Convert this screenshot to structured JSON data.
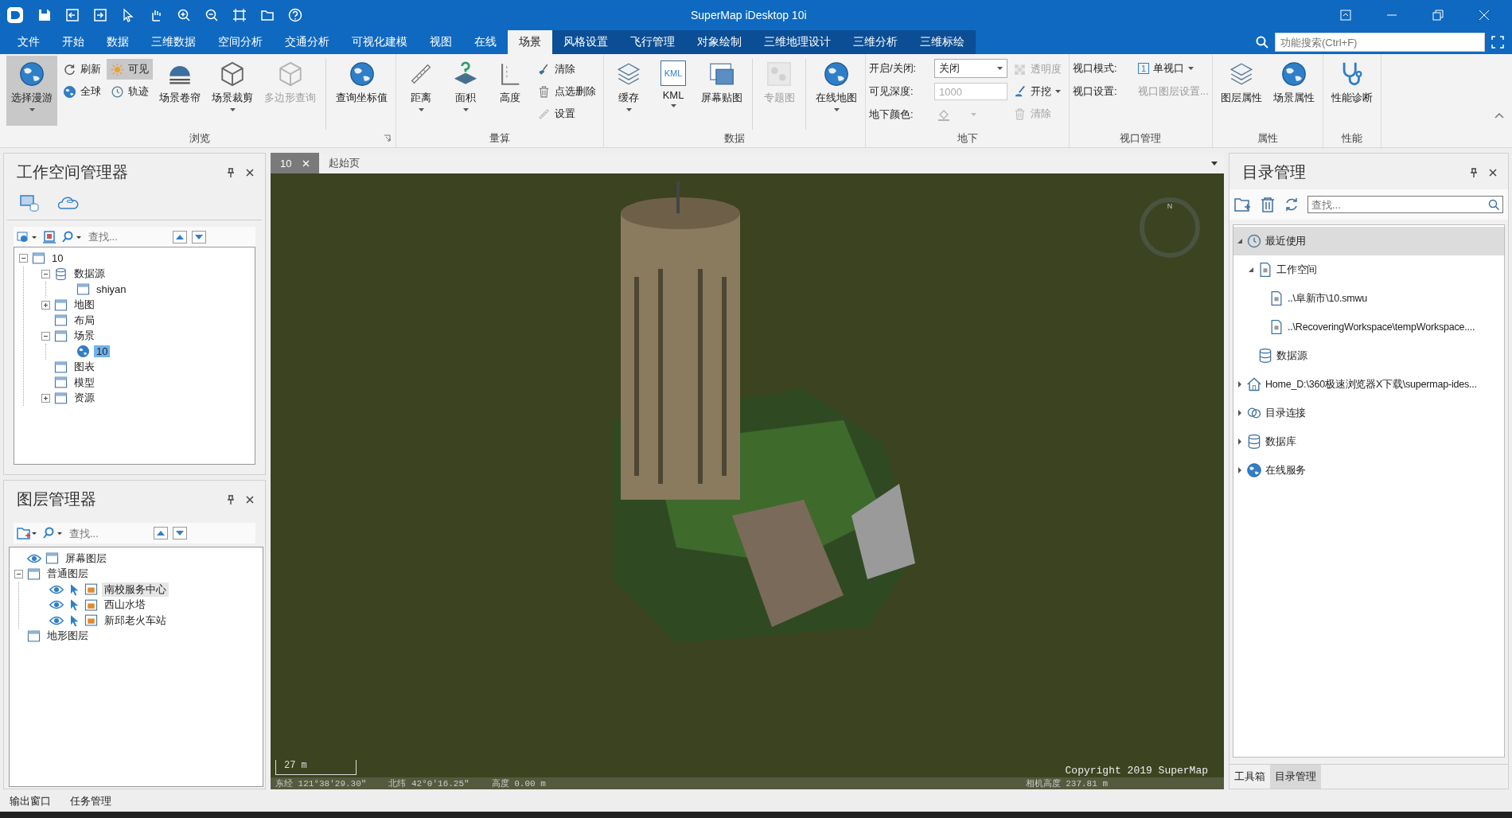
{
  "window": {
    "title": "SuperMap iDesktop 10i"
  },
  "menu_tabs": [
    {
      "label": "文件",
      "kind": "main",
      "selected": false
    },
    {
      "label": "开始",
      "kind": "main",
      "selected": false
    },
    {
      "label": "数据",
      "kind": "main",
      "selected": false
    },
    {
      "label": "三维数据",
      "kind": "main",
      "selected": false
    },
    {
      "label": "空间分析",
      "kind": "main",
      "selected": false
    },
    {
      "label": "交通分析",
      "kind": "main",
      "selected": false
    },
    {
      "label": "可视化建模",
      "kind": "main",
      "selected": false
    },
    {
      "label": "视图",
      "kind": "main",
      "selected": false
    },
    {
      "label": "在线",
      "kind": "main",
      "selected": false
    },
    {
      "label": "场景",
      "kind": "main",
      "selected": true
    },
    {
      "label": "风格设置",
      "kind": "context",
      "selected": false
    },
    {
      "label": "飞行管理",
      "kind": "context",
      "selected": false
    },
    {
      "label": "对象绘制",
      "kind": "context",
      "selected": false
    },
    {
      "label": "三维地理设计",
      "kind": "context",
      "selected": false
    },
    {
      "label": "三维分析",
      "kind": "context",
      "selected": false
    },
    {
      "label": "三维标绘",
      "kind": "context",
      "selected": false
    }
  ],
  "function_search": {
    "placeholder": "功能搜索(Ctrl+F)"
  },
  "ribbon": [
    {
      "label": "浏览",
      "launcher": true,
      "items": [
        {
          "kind": "large",
          "label": "选择漫游",
          "selected": true,
          "disabled": false,
          "dropdown": true
        },
        {
          "kind": "column",
          "items": [
            {
              "label": "刷新",
              "selected": false,
              "disabled": false,
              "dropdown": false
            },
            {
              "label": "全球",
              "selected": false,
              "disabled": false,
              "dropdown": false
            }
          ]
        },
        {
          "kind": "column",
          "items": [
            {
              "label": "可见",
              "selected": true,
              "disabled": false,
              "dropdown": false
            },
            {
              "label": "轨迹",
              "selected": false,
              "disabled": false,
              "dropdown": false
            }
          ]
        },
        {
          "kind": "large",
          "label": "场景卷帘",
          "selected": false,
          "disabled": false,
          "dropdown": false
        },
        {
          "kind": "large",
          "label": "场景裁剪",
          "selected": false,
          "disabled": false,
          "dropdown": true
        },
        {
          "kind": "large",
          "label": "多边形查询",
          "selected": false,
          "disabled": true,
          "dropdown": false
        },
        {
          "kind": "separator"
        },
        {
          "kind": "large",
          "label": "查询坐标值",
          "selected": false,
          "disabled": false,
          "dropdown": false
        }
      ]
    },
    {
      "label": "量算",
      "items": [
        {
          "kind": "large",
          "label": "距离",
          "selected": false,
          "disabled": false,
          "dropdown": true
        },
        {
          "kind": "large",
          "label": "面积",
          "selected": false,
          "disabled": false,
          "dropdown": true
        },
        {
          "kind": "large",
          "label": "高度",
          "selected": false,
          "disabled": false,
          "dropdown": false
        },
        {
          "kind": "column",
          "items": [
            {
              "label": "清除",
              "selected": false,
              "disabled": false,
              "dropdown": false
            },
            {
              "label": "点选删除",
              "selected": false,
              "disabled": false,
              "dropdown": false
            },
            {
              "label": "设置",
              "selected": false,
              "disabled": false,
              "dropdown": false
            }
          ]
        }
      ]
    },
    {
      "label": "数据",
      "items": [
        {
          "kind": "large",
          "label": "缓存",
          "selected": false,
          "disabled": false,
          "dropdown": true
        },
        {
          "kind": "large",
          "label": "KML",
          "icon_text": "KML",
          "selected": false,
          "disabled": false,
          "dropdown": true
        },
        {
          "kind": "large",
          "label": "屏幕贴图",
          "selected": false,
          "disabled": false,
          "dropdown": false
        },
        {
          "kind": "separator"
        },
        {
          "kind": "large",
          "label": "专题图",
          "selected": false,
          "disabled": true,
          "dropdown": false
        },
        {
          "kind": "separator"
        },
        {
          "kind": "large",
          "label": "在线地图",
          "selected": false,
          "disabled": false,
          "dropdown": true
        }
      ]
    },
    {
      "label": "地下",
      "items": [
        {
          "kind": "form",
          "rows": [
            {
              "label": "开启/关闭:",
              "kind": "select",
              "value": "关闭"
            },
            {
              "label": "可见深度:",
              "kind": "input",
              "value": "1000",
              "disabled": true
            },
            {
              "label": "地下颜色:",
              "kind": "color",
              "disabled": true
            }
          ]
        },
        {
          "kind": "column",
          "items": [
            {
              "label": "透明度",
              "selected": false,
              "disabled": true,
              "dropdown": false
            },
            {
              "label": "开挖",
              "selected": false,
              "disabled": false,
              "dropdown": true
            },
            {
              "label": "清除",
              "selected": false,
              "disabled": true,
              "dropdown": false
            }
          ]
        }
      ]
    },
    {
      "label": "视口管理",
      "items": [
        {
          "kind": "form",
          "rows": [
            {
              "label": "视口模式:",
              "kind": "menu",
              "badge": "1",
              "value": "单视口"
            },
            {
              "label": "视口设置:",
              "kind": "link",
              "value": "视口图层设置...",
              "disabled": true
            }
          ]
        }
      ]
    },
    {
      "label": "属性",
      "items": [
        {
          "kind": "large",
          "label": "图层属性",
          "selected": false,
          "disabled": false,
          "dropdown": false
        },
        {
          "kind": "large",
          "label": "场景属性",
          "selected": false,
          "disabled": false,
          "dropdown": false
        }
      ]
    },
    {
      "label": "性能",
      "items": [
        {
          "kind": "large",
          "label": "性能诊断",
          "selected": false,
          "disabled": false,
          "dropdown": false
        }
      ]
    }
  ],
  "workspace_manager": {
    "title": "工作空间管理器",
    "search_placeholder": "查找...",
    "tree": [
      {
        "label": "10",
        "expanded": true,
        "selected": false,
        "children": [
          {
            "label": "数据源",
            "expanded": true,
            "selected": false,
            "children": [
              {
                "label": "shiyan",
                "selected": false
              }
            ]
          },
          {
            "label": "地图",
            "expanded": false,
            "selected": false
          },
          {
            "label": "布局",
            "selected": false
          },
          {
            "label": "场景",
            "expanded": true,
            "selected": false,
            "children": [
              {
                "label": "10",
                "selected": true
              }
            ]
          },
          {
            "label": "图表",
            "selected": false
          },
          {
            "label": "模型",
            "selected": false
          },
          {
            "label": "资源",
            "expanded": false,
            "selected": false
          }
        ]
      }
    ]
  },
  "layer_manager": {
    "title": "图层管理器",
    "search_placeholder": "查找...",
    "tree": [
      {
        "label": "屏幕图层",
        "visible": true,
        "selected": false
      },
      {
        "label": "普通图层",
        "expanded": true,
        "selected": false,
        "children": [
          {
            "label": "南校服务中心",
            "visible": true,
            "selectable": true,
            "selected": true
          },
          {
            "label": "西山水塔",
            "visible": true,
            "selectable": true,
            "selected": false
          },
          {
            "label": "新邱老火车站",
            "visible": true,
            "selectable": true,
            "selected": false
          }
        ]
      },
      {
        "label": "地形图层",
        "selected": false
      }
    ]
  },
  "document_tabs": [
    {
      "label": "10",
      "selected": true,
      "closable": true
    },
    {
      "label": "起始页",
      "selected": false,
      "closable": false
    }
  ],
  "scene": {
    "compass_label": "N",
    "scale_label": "27 m",
    "copyright": "Copyright 2019 SuperMap",
    "status": [
      "东经 121°38′29.30″",
      "北纬 42°0′16.25″",
      "高度 0.00 m"
    ],
    "camera_height": "相机高度 237.81 m"
  },
  "catalog": {
    "title": "目录管理",
    "search_placeholder": "查找...",
    "tree": [
      {
        "label": "最近使用",
        "expanded": true,
        "selected": true,
        "children": [
          {
            "label": "工作空间",
            "expanded": true,
            "selected": false,
            "children": [
              {
                "label": "..\\阜新市\\10.smwu",
                "selected": false
              },
              {
                "label": "..\\RecoveringWorkspace\\tempWorkspace....",
                "selected": false
              }
            ]
          },
          {
            "label": "数据源",
            "selected": false
          }
        ]
      },
      {
        "label": "Home_D:\\360极速浏览器X下载\\supermap-ides...",
        "expanded": false,
        "selected": false
      },
      {
        "label": "目录连接",
        "expanded": false,
        "selected": false
      },
      {
        "label": "数据库",
        "expanded": false,
        "selected": false
      },
      {
        "label": "在线服务",
        "expanded": false,
        "selected": false
      }
    ]
  },
  "right_tabs": [
    {
      "label": "工具箱",
      "selected": false
    },
    {
      "label": "目录管理",
      "selected": true
    }
  ],
  "bottom_tabs": [
    {
      "label": "输出窗口"
    },
    {
      "label": "任务管理"
    }
  ]
}
